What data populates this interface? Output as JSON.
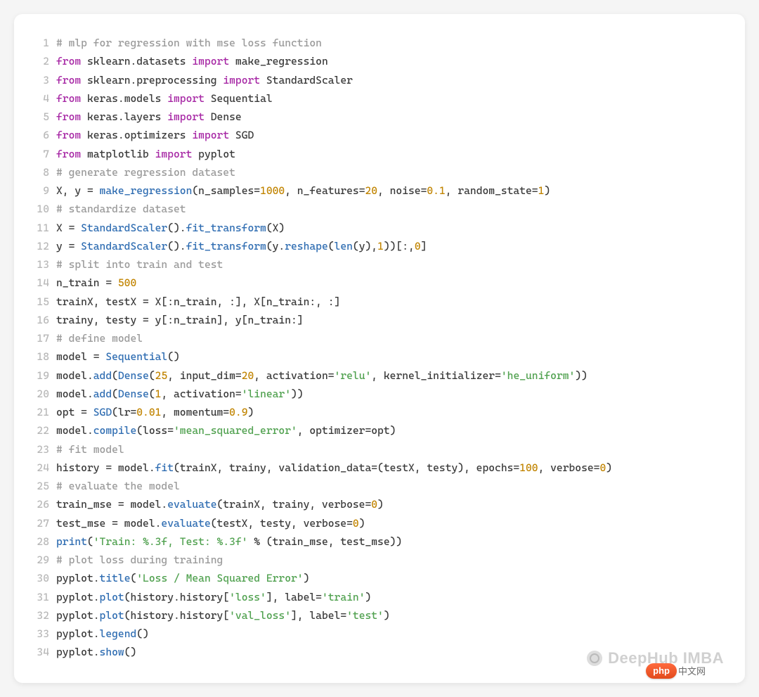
{
  "watermark": "DeepHub IMBA",
  "badge_text": "php",
  "badge_tail": "中文网",
  "lines": [
    {
      "n": 1,
      "tokens": [
        {
          "cls": "c",
          "t": "# mlp for regression with mse loss function"
        }
      ]
    },
    {
      "n": 2,
      "tokens": [
        {
          "cls": "k",
          "t": "from"
        },
        {
          "cls": "p",
          "t": " "
        },
        {
          "cls": "m",
          "t": "sklearn.datasets"
        },
        {
          "cls": "p",
          "t": " "
        },
        {
          "cls": "k",
          "t": "import"
        },
        {
          "cls": "p",
          "t": " "
        },
        {
          "cls": "m",
          "t": "make_regression"
        }
      ]
    },
    {
      "n": 3,
      "tokens": [
        {
          "cls": "k",
          "t": "from"
        },
        {
          "cls": "p",
          "t": " "
        },
        {
          "cls": "m",
          "t": "sklearn.preprocessing"
        },
        {
          "cls": "p",
          "t": " "
        },
        {
          "cls": "k",
          "t": "import"
        },
        {
          "cls": "p",
          "t": " "
        },
        {
          "cls": "m",
          "t": "StandardScaler"
        }
      ]
    },
    {
      "n": 4,
      "tokens": [
        {
          "cls": "k",
          "t": "from"
        },
        {
          "cls": "p",
          "t": " "
        },
        {
          "cls": "m",
          "t": "keras.models"
        },
        {
          "cls": "p",
          "t": " "
        },
        {
          "cls": "k",
          "t": "import"
        },
        {
          "cls": "p",
          "t": " "
        },
        {
          "cls": "m",
          "t": "Sequential"
        }
      ]
    },
    {
      "n": 5,
      "tokens": [
        {
          "cls": "k",
          "t": "from"
        },
        {
          "cls": "p",
          "t": " "
        },
        {
          "cls": "m",
          "t": "keras.layers"
        },
        {
          "cls": "p",
          "t": " "
        },
        {
          "cls": "k",
          "t": "import"
        },
        {
          "cls": "p",
          "t": " "
        },
        {
          "cls": "m",
          "t": "Dense"
        }
      ]
    },
    {
      "n": 6,
      "tokens": [
        {
          "cls": "k",
          "t": "from"
        },
        {
          "cls": "p",
          "t": " "
        },
        {
          "cls": "m",
          "t": "keras.optimizers"
        },
        {
          "cls": "p",
          "t": " "
        },
        {
          "cls": "k",
          "t": "import"
        },
        {
          "cls": "p",
          "t": " "
        },
        {
          "cls": "m",
          "t": "SGD"
        }
      ]
    },
    {
      "n": 7,
      "tokens": [
        {
          "cls": "k",
          "t": "from"
        },
        {
          "cls": "p",
          "t": " "
        },
        {
          "cls": "m",
          "t": "matplotlib"
        },
        {
          "cls": "p",
          "t": " "
        },
        {
          "cls": "k",
          "t": "import"
        },
        {
          "cls": "p",
          "t": " "
        },
        {
          "cls": "m",
          "t": "pyplot"
        }
      ]
    },
    {
      "n": 8,
      "tokens": [
        {
          "cls": "c",
          "t": "# generate regression dataset"
        }
      ]
    },
    {
      "n": 9,
      "tokens": [
        {
          "cls": "id",
          "t": "X, y = "
        },
        {
          "cls": "fn",
          "t": "make_regression"
        },
        {
          "cls": "p",
          "t": "(n_samples="
        },
        {
          "cls": "n",
          "t": "1000"
        },
        {
          "cls": "p",
          "t": ", n_features="
        },
        {
          "cls": "n",
          "t": "20"
        },
        {
          "cls": "p",
          "t": ", noise="
        },
        {
          "cls": "n",
          "t": "0.1"
        },
        {
          "cls": "p",
          "t": ", random_state="
        },
        {
          "cls": "n",
          "t": "1"
        },
        {
          "cls": "p",
          "t": ")"
        }
      ]
    },
    {
      "n": 10,
      "tokens": [
        {
          "cls": "c",
          "t": "# standardize dataset"
        }
      ]
    },
    {
      "n": 11,
      "tokens": [
        {
          "cls": "id",
          "t": "X = "
        },
        {
          "cls": "fn",
          "t": "StandardScaler"
        },
        {
          "cls": "p",
          "t": "()."
        },
        {
          "cls": "fn",
          "t": "fit_transform"
        },
        {
          "cls": "p",
          "t": "(X)"
        }
      ]
    },
    {
      "n": 12,
      "tokens": [
        {
          "cls": "id",
          "t": "y = "
        },
        {
          "cls": "fn",
          "t": "StandardScaler"
        },
        {
          "cls": "p",
          "t": "()."
        },
        {
          "cls": "fn",
          "t": "fit_transform"
        },
        {
          "cls": "p",
          "t": "(y."
        },
        {
          "cls": "fn",
          "t": "reshape"
        },
        {
          "cls": "p",
          "t": "("
        },
        {
          "cls": "fn",
          "t": "len"
        },
        {
          "cls": "p",
          "t": "(y),"
        },
        {
          "cls": "n",
          "t": "1"
        },
        {
          "cls": "p",
          "t": "))[:,"
        },
        {
          "cls": "n",
          "t": "0"
        },
        {
          "cls": "p",
          "t": "]"
        }
      ]
    },
    {
      "n": 13,
      "tokens": [
        {
          "cls": "c",
          "t": "# split into train and test"
        }
      ]
    },
    {
      "n": 14,
      "tokens": [
        {
          "cls": "id",
          "t": "n_train = "
        },
        {
          "cls": "n",
          "t": "500"
        }
      ]
    },
    {
      "n": 15,
      "tokens": [
        {
          "cls": "id",
          "t": "trainX, testX = X[:n_train, :], X[n_train:, :]"
        }
      ]
    },
    {
      "n": 16,
      "tokens": [
        {
          "cls": "id",
          "t": "trainy, testy = y[:n_train], y[n_train:]"
        }
      ]
    },
    {
      "n": 17,
      "tokens": [
        {
          "cls": "c",
          "t": "# define model"
        }
      ]
    },
    {
      "n": 18,
      "tokens": [
        {
          "cls": "id",
          "t": "model = "
        },
        {
          "cls": "fn",
          "t": "Sequential"
        },
        {
          "cls": "p",
          "t": "()"
        }
      ]
    },
    {
      "n": 19,
      "tokens": [
        {
          "cls": "id",
          "t": "model."
        },
        {
          "cls": "fn",
          "t": "add"
        },
        {
          "cls": "p",
          "t": "("
        },
        {
          "cls": "fn",
          "t": "Dense"
        },
        {
          "cls": "p",
          "t": "("
        },
        {
          "cls": "n",
          "t": "25"
        },
        {
          "cls": "p",
          "t": ", input_dim="
        },
        {
          "cls": "n",
          "t": "20"
        },
        {
          "cls": "p",
          "t": ", activation="
        },
        {
          "cls": "s",
          "t": "'relu'"
        },
        {
          "cls": "p",
          "t": ", kernel_initializer="
        },
        {
          "cls": "s",
          "t": "'he_uniform'"
        },
        {
          "cls": "p",
          "t": "))"
        }
      ]
    },
    {
      "n": 20,
      "tokens": [
        {
          "cls": "id",
          "t": "model."
        },
        {
          "cls": "fn",
          "t": "add"
        },
        {
          "cls": "p",
          "t": "("
        },
        {
          "cls": "fn",
          "t": "Dense"
        },
        {
          "cls": "p",
          "t": "("
        },
        {
          "cls": "n",
          "t": "1"
        },
        {
          "cls": "p",
          "t": ", activation="
        },
        {
          "cls": "s",
          "t": "'linear'"
        },
        {
          "cls": "p",
          "t": "))"
        }
      ]
    },
    {
      "n": 21,
      "tokens": [
        {
          "cls": "id",
          "t": "opt = "
        },
        {
          "cls": "fn",
          "t": "SGD"
        },
        {
          "cls": "p",
          "t": "(lr="
        },
        {
          "cls": "n",
          "t": "0.01"
        },
        {
          "cls": "p",
          "t": ", momentum="
        },
        {
          "cls": "n",
          "t": "0.9"
        },
        {
          "cls": "p",
          "t": ")"
        }
      ]
    },
    {
      "n": 22,
      "tokens": [
        {
          "cls": "id",
          "t": "model."
        },
        {
          "cls": "fn",
          "t": "compile"
        },
        {
          "cls": "p",
          "t": "(loss="
        },
        {
          "cls": "s",
          "t": "'mean_squared_error'"
        },
        {
          "cls": "p",
          "t": ", optimizer=opt)"
        }
      ]
    },
    {
      "n": 23,
      "tokens": [
        {
          "cls": "c",
          "t": "# fit model"
        }
      ]
    },
    {
      "n": 24,
      "tokens": [
        {
          "cls": "id",
          "t": "history = model."
        },
        {
          "cls": "fn",
          "t": "fit"
        },
        {
          "cls": "p",
          "t": "(trainX, trainy, validation_data=(testX, testy), epochs="
        },
        {
          "cls": "n",
          "t": "100"
        },
        {
          "cls": "p",
          "t": ", verbose="
        },
        {
          "cls": "n",
          "t": "0"
        },
        {
          "cls": "p",
          "t": ")"
        }
      ]
    },
    {
      "n": 25,
      "tokens": [
        {
          "cls": "c",
          "t": "# evaluate the model"
        }
      ]
    },
    {
      "n": 26,
      "tokens": [
        {
          "cls": "id",
          "t": "train_mse = model."
        },
        {
          "cls": "fn",
          "t": "evaluate"
        },
        {
          "cls": "p",
          "t": "(trainX, trainy, verbose="
        },
        {
          "cls": "n",
          "t": "0"
        },
        {
          "cls": "p",
          "t": ")"
        }
      ]
    },
    {
      "n": 27,
      "tokens": [
        {
          "cls": "id",
          "t": "test_mse = model."
        },
        {
          "cls": "fn",
          "t": "evaluate"
        },
        {
          "cls": "p",
          "t": "(testX, testy, verbose="
        },
        {
          "cls": "n",
          "t": "0"
        },
        {
          "cls": "p",
          "t": ")"
        }
      ]
    },
    {
      "n": 28,
      "tokens": [
        {
          "cls": "fn",
          "t": "print"
        },
        {
          "cls": "p",
          "t": "("
        },
        {
          "cls": "s",
          "t": "'Train: %.3f, Test: %.3f'"
        },
        {
          "cls": "p",
          "t": " % (train_mse, test_mse))"
        }
      ]
    },
    {
      "n": 29,
      "tokens": [
        {
          "cls": "c",
          "t": "# plot loss during training"
        }
      ]
    },
    {
      "n": 30,
      "tokens": [
        {
          "cls": "id",
          "t": "pyplot."
        },
        {
          "cls": "fn",
          "t": "title"
        },
        {
          "cls": "p",
          "t": "("
        },
        {
          "cls": "s",
          "t": "'Loss / Mean Squared Error'"
        },
        {
          "cls": "p",
          "t": ")"
        }
      ]
    },
    {
      "n": 31,
      "tokens": [
        {
          "cls": "id",
          "t": "pyplot."
        },
        {
          "cls": "fn",
          "t": "plot"
        },
        {
          "cls": "p",
          "t": "(history.history["
        },
        {
          "cls": "s",
          "t": "'loss'"
        },
        {
          "cls": "p",
          "t": "], label="
        },
        {
          "cls": "s",
          "t": "'train'"
        },
        {
          "cls": "p",
          "t": ")"
        }
      ]
    },
    {
      "n": 32,
      "tokens": [
        {
          "cls": "id",
          "t": "pyplot."
        },
        {
          "cls": "fn",
          "t": "plot"
        },
        {
          "cls": "p",
          "t": "(history.history["
        },
        {
          "cls": "s",
          "t": "'val_loss'"
        },
        {
          "cls": "p",
          "t": "], label="
        },
        {
          "cls": "s",
          "t": "'test'"
        },
        {
          "cls": "p",
          "t": ")"
        }
      ]
    },
    {
      "n": 33,
      "tokens": [
        {
          "cls": "id",
          "t": "pyplot."
        },
        {
          "cls": "fn",
          "t": "legend"
        },
        {
          "cls": "p",
          "t": "()"
        }
      ]
    },
    {
      "n": 34,
      "tokens": [
        {
          "cls": "id",
          "t": "pyplot."
        },
        {
          "cls": "fn",
          "t": "show"
        },
        {
          "cls": "p",
          "t": "()"
        }
      ]
    }
  ]
}
